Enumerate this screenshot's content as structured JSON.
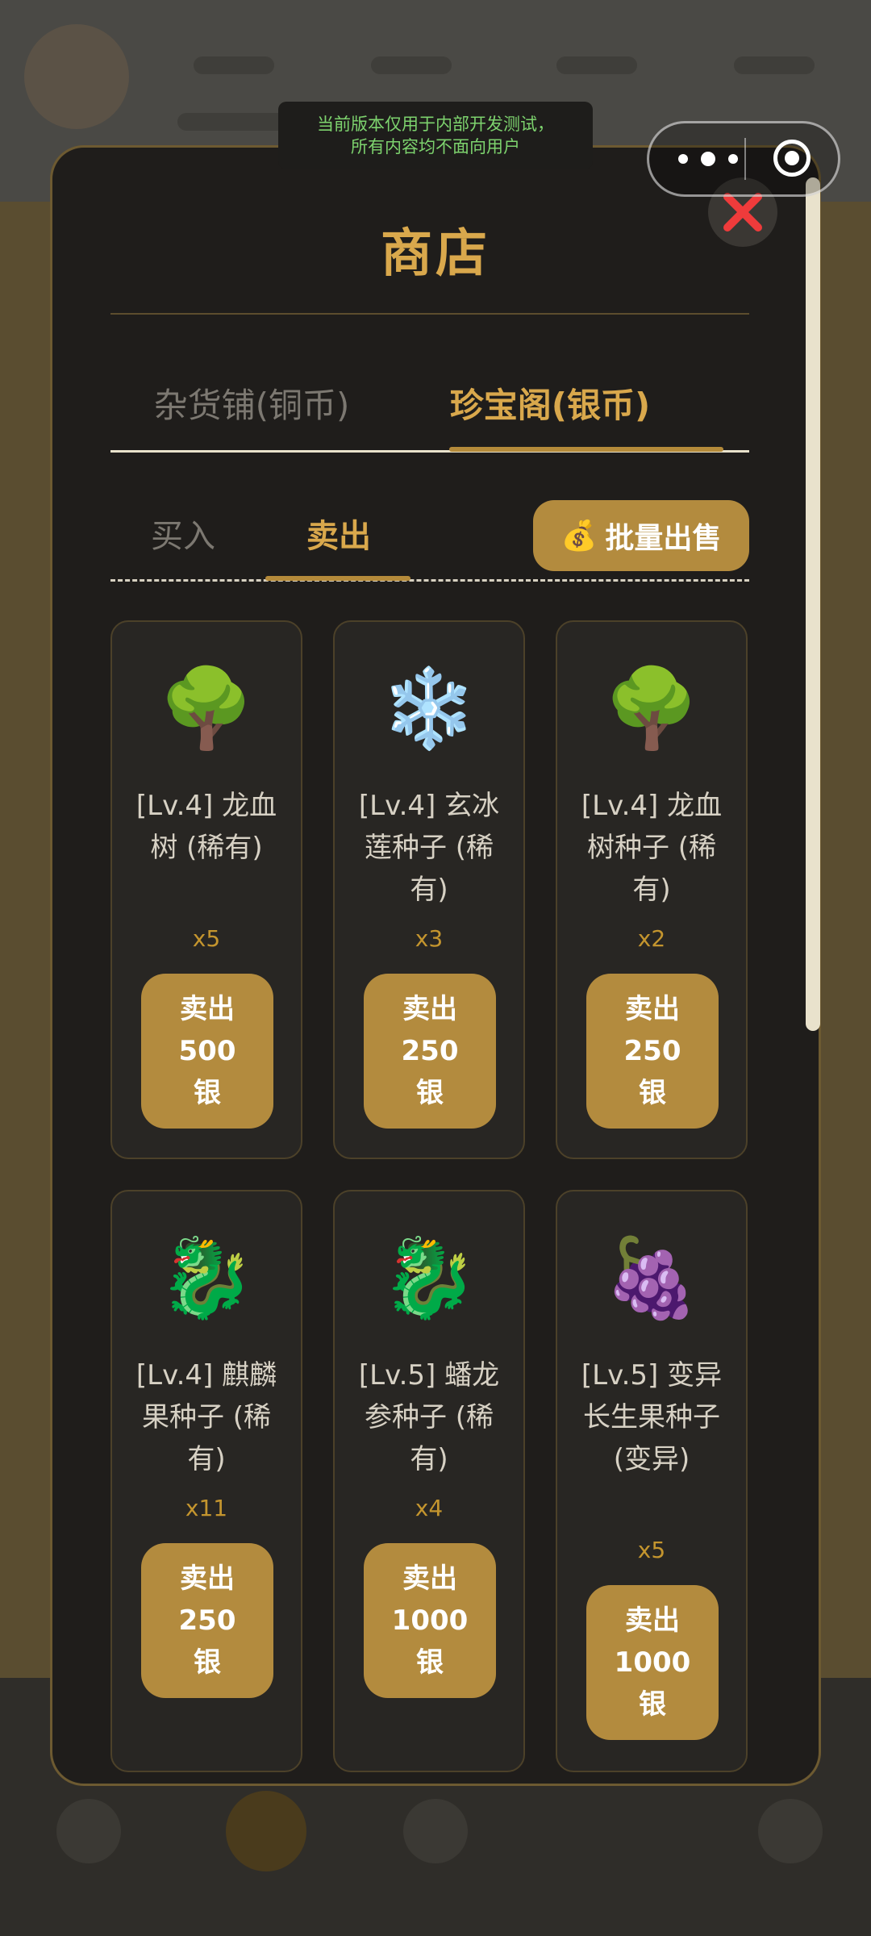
{
  "notice": {
    "line1": "当前版本仅用于内部开发测试，",
    "line2": "所有内容均不面向用户"
  },
  "shop": {
    "title": "商店",
    "close_icon": "close-x-icon",
    "tabs": [
      {
        "label": "杂货铺(铜币)",
        "active": false
      },
      {
        "label": "珍宝阁(银币)",
        "active": true
      }
    ],
    "subtabs": [
      {
        "label": "买入",
        "active": false
      },
      {
        "label": "卖出",
        "active": true
      }
    ],
    "bulk_sell": {
      "icon": "💰",
      "label": "批量出售"
    },
    "items": [
      {
        "icon": "🌳",
        "name": "[Lv.4] 龙血树 (稀有)",
        "qty": "x5",
        "sell_label": "卖出",
        "price": "500",
        "unit": "银"
      },
      {
        "icon": "❄️",
        "name": "[Lv.4] 玄冰莲种子 (稀有)",
        "qty": "x3",
        "sell_label": "卖出",
        "price": "250",
        "unit": "银"
      },
      {
        "icon": "🌳",
        "name": "[Lv.4] 龙血树种子 (稀有)",
        "qty": "x2",
        "sell_label": "卖出",
        "price": "250",
        "unit": "银"
      },
      {
        "icon": "🐉",
        "name": "[Lv.4] 麒麟果种子 (稀有)",
        "qty": "x11",
        "sell_label": "卖出",
        "price": "250",
        "unit": "银"
      },
      {
        "icon": "🐉",
        "name": "[Lv.5] 蟠龙参种子 (稀有)",
        "qty": "x4",
        "sell_label": "卖出",
        "price": "1000",
        "unit": "银"
      },
      {
        "icon": "🍇",
        "name": "[Lv.5] 变异长生果种子 (变异)",
        "qty": "x5",
        "sell_label": "卖出",
        "price": "1000",
        "unit": "银"
      }
    ]
  },
  "colors": {
    "accent_gold": "#d9a84c",
    "button_gold": "#b38b3e",
    "modal_bg": "#1f1d1b",
    "card_bg": "#282623",
    "notice_text": "#7dd36e"
  }
}
